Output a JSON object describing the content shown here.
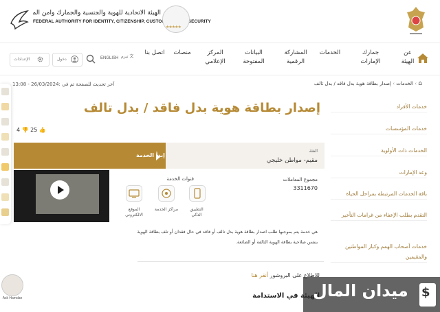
{
  "header": {
    "authority_ar": "الهيئة الاتحادية للهوية والجنسية والجمارك وأمن المنافذ",
    "authority_en": "FEDERAL AUTHORITY FOR IDENTITY, CITIZENSHIP, CUSTOMS & PORT SECURITY",
    "stars": "★★★★★"
  },
  "nav": {
    "items": [
      {
        "label": "عن الهيئة"
      },
      {
        "label": "جمارك الإمارات"
      },
      {
        "label": "الخدمات"
      },
      {
        "label": "المشاركة الرقمية"
      },
      {
        "label": "البيانات المفتوحة"
      },
      {
        "label": "المركز الإعلامي"
      },
      {
        "label": "منصات"
      },
      {
        "label": "اتصل بنا"
      }
    ],
    "lang_label": "ENGLISH",
    "lang_secondary": "تيرم",
    "login_label": "دخول",
    "settings_label": "الإعدادات"
  },
  "breadcrumb": {
    "home": "الخدمات",
    "current": "إصدار بطاقة هوية بدل فاقد / بدل تالف"
  },
  "updated_text": "آخر تحديث للصفحة تم في :26/03/2024 - 13:08",
  "service": {
    "title": "إصدار بطاقة هوية بدل فاقد / بدل تالف",
    "likes": "25",
    "dislikes": "4",
    "category_label": "الفئة",
    "category_value": "مقيم- مواطن خليجي",
    "start_label": "إبدأ الخدمة",
    "txn_label": "مجموع المعاملات",
    "txn_value": "3311670",
    "channels_title": "قنوات الخدمة",
    "channels": [
      {
        "label": "التطبيق الذكي"
      },
      {
        "label": "مراكز الخدمة"
      },
      {
        "label": "الموقع الالكتروني"
      }
    ],
    "description": "هي خدمة يتم بموجبها طلب اصدار بطاقة هوية بدل تالف أو فاقد في حال فقدان أو تلف بطاقة الهوية بنفس صلاحية بطاقة الهوية التالفة أو الضائعة.",
    "brochure_prefix": "للاطلاع على البروشور",
    "brochure_link": "أنقر هنا",
    "sustain_heading": "الهيئة في الاستدامة"
  },
  "sidebar": {
    "items": [
      {
        "label": "خدمات الأفراد"
      },
      {
        "label": "خدمات المؤسسات"
      },
      {
        "label": "الخدمات ذات الأولوية"
      },
      {
        "label": "وعد الإمارات"
      },
      {
        "label": "باقة الخدمات المرتبطة بمراحل الحياة"
      },
      {
        "label": "التقدم بطلب الإعفاء من غرامات التأخير"
      },
      {
        "label": "خدمات أصحاب الهمم وكبار المواطنين والمقيمين"
      }
    ]
  },
  "chat": {
    "label": "Ask Hamdan"
  },
  "watermark": {
    "text": "ميدان المال",
    "symbol": "$"
  },
  "colors": {
    "accent": "#b68a35",
    "band_light": "#f4f1ec",
    "dark": "#1b1b1b"
  }
}
